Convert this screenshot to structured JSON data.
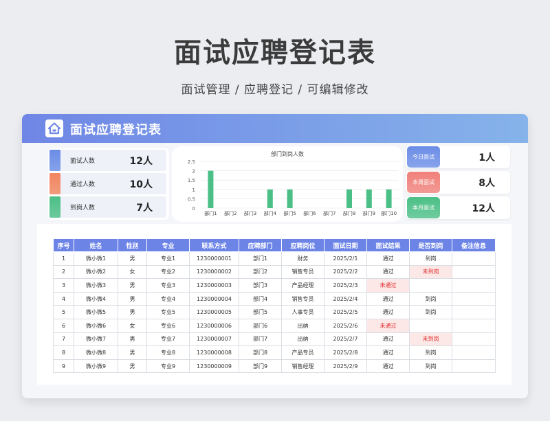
{
  "page": {
    "title": "面试应聘登记表",
    "subtitle": "面试管理 /  应聘登记  /  可编辑修改"
  },
  "card": {
    "title": "面试应聘登记表"
  },
  "stats": [
    {
      "label": "面试人数",
      "value": "12人",
      "color": "#6b8de6"
    },
    {
      "label": "通过人数",
      "value": "10人",
      "color": "#f2855f"
    },
    {
      "label": "到岗人数",
      "value": "7人",
      "color": "#4cbf86"
    }
  ],
  "right_stats": [
    {
      "label": "今日面试",
      "value": "1人",
      "color": "#6b8de6"
    },
    {
      "label": "本周面试",
      "value": "8人",
      "color": "#f0807a"
    },
    {
      "label": "本月面试",
      "value": "12人",
      "color": "#4cbf86"
    }
  ],
  "chart_data": {
    "type": "bar",
    "title": "部门到岗人数",
    "categories": [
      "部门1",
      "部门2",
      "部门3",
      "部门4",
      "部门5",
      "部门6",
      "部门7",
      "部门8",
      "部门9",
      "部门10"
    ],
    "values": [
      2,
      0,
      0,
      1,
      1,
      0,
      0,
      1,
      1,
      1
    ],
    "ylim": [
      0,
      2.5
    ],
    "yticks": [
      "0",
      "0.5",
      "1",
      "1.5",
      "2",
      "2.5"
    ],
    "grid": true,
    "color": "#4cbf86"
  },
  "table": {
    "headers": [
      "序号",
      "姓名",
      "性别",
      "专业",
      "联系方式",
      "应聘部门",
      "应聘岗位",
      "面试日期",
      "面试结果",
      "是否到岗",
      "备注信息"
    ],
    "rows": [
      [
        "1",
        "微小微1",
        "男",
        "专业1",
        "1230000001",
        "部门1",
        "财务",
        "2025/2/1",
        "通过",
        "到岗",
        ""
      ],
      [
        "2",
        "微小微2",
        "女",
        "专业2",
        "1230000002",
        "部门2",
        "销售专员",
        "2025/2/2",
        "通过",
        "未到岗",
        ""
      ],
      [
        "3",
        "微小微3",
        "男",
        "专业3",
        "1230000003",
        "部门3",
        "产品经理",
        "2025/2/3",
        "未通过",
        "",
        ""
      ],
      [
        "4",
        "微小微4",
        "男",
        "专业4",
        "1230000004",
        "部门4",
        "销售专员",
        "2025/2/4",
        "通过",
        "到岗",
        ""
      ],
      [
        "5",
        "微小微5",
        "男",
        "专业5",
        "1230000005",
        "部门5",
        "人事专员",
        "2025/2/5",
        "通过",
        "到岗",
        ""
      ],
      [
        "6",
        "微小微6",
        "女",
        "专业6",
        "1230000006",
        "部门6",
        "出纳",
        "2025/2/6",
        "未通过",
        "",
        ""
      ],
      [
        "7",
        "微小微7",
        "男",
        "专业7",
        "1230000007",
        "部门7",
        "出纳",
        "2025/2/7",
        "通过",
        "未到岗",
        ""
      ],
      [
        "8",
        "微小微8",
        "男",
        "专业8",
        "1230000008",
        "部门8",
        "产品专员",
        "2025/2/8",
        "通过",
        "到岗",
        ""
      ],
      [
        "9",
        "微小微9",
        "男",
        "专业9",
        "1230000009",
        "部门9",
        "销售经理",
        "2025/2/9",
        "通过",
        "到岗",
        ""
      ]
    ]
  }
}
